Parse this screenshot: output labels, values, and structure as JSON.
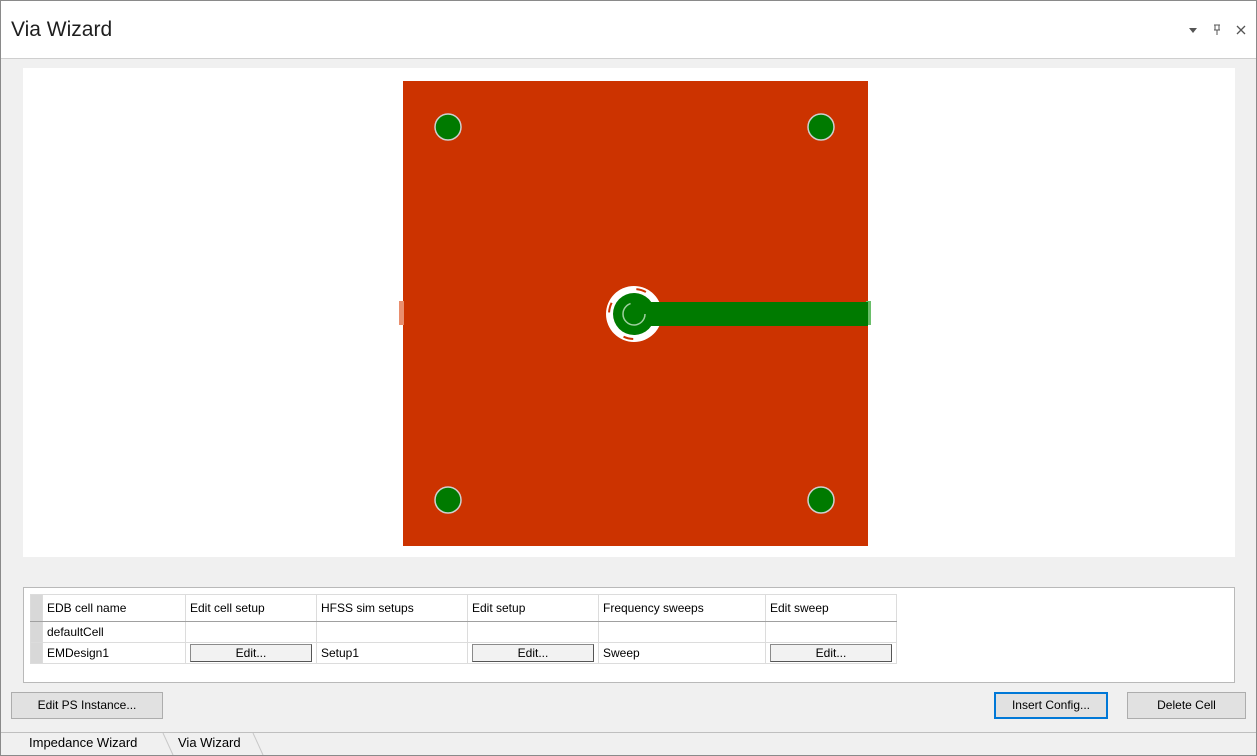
{
  "window": {
    "title": "Via Wizard"
  },
  "colors": {
    "board": "#cc3300",
    "conductor": "#007a00",
    "conductor_light": "#6abf6a",
    "antipad": "#ffffff"
  },
  "table": {
    "headers": [
      "EDB cell name",
      "Edit cell setup",
      "HFSS sim setups",
      "Edit setup",
      "Frequency sweeps",
      "Edit sweep"
    ],
    "rows": [
      {
        "cell": "defaultCell",
        "setup": "",
        "sweep": ""
      },
      {
        "cell": "EMDesign1",
        "edit_cell": "Edit...",
        "setup": "Setup1",
        "edit_setup": "Edit...",
        "sweep": "Sweep",
        "edit_sweep": "Edit..."
      }
    ]
  },
  "buttons": {
    "edit_ps_instance": "Edit PS Instance...",
    "insert_config": "Insert Config...",
    "delete_cell": "Delete Cell"
  },
  "tabs": [
    "Impedance Wizard",
    "Via Wizard"
  ],
  "icons": [
    "dropdown-arrow-icon",
    "pin-icon",
    "close-icon"
  ]
}
